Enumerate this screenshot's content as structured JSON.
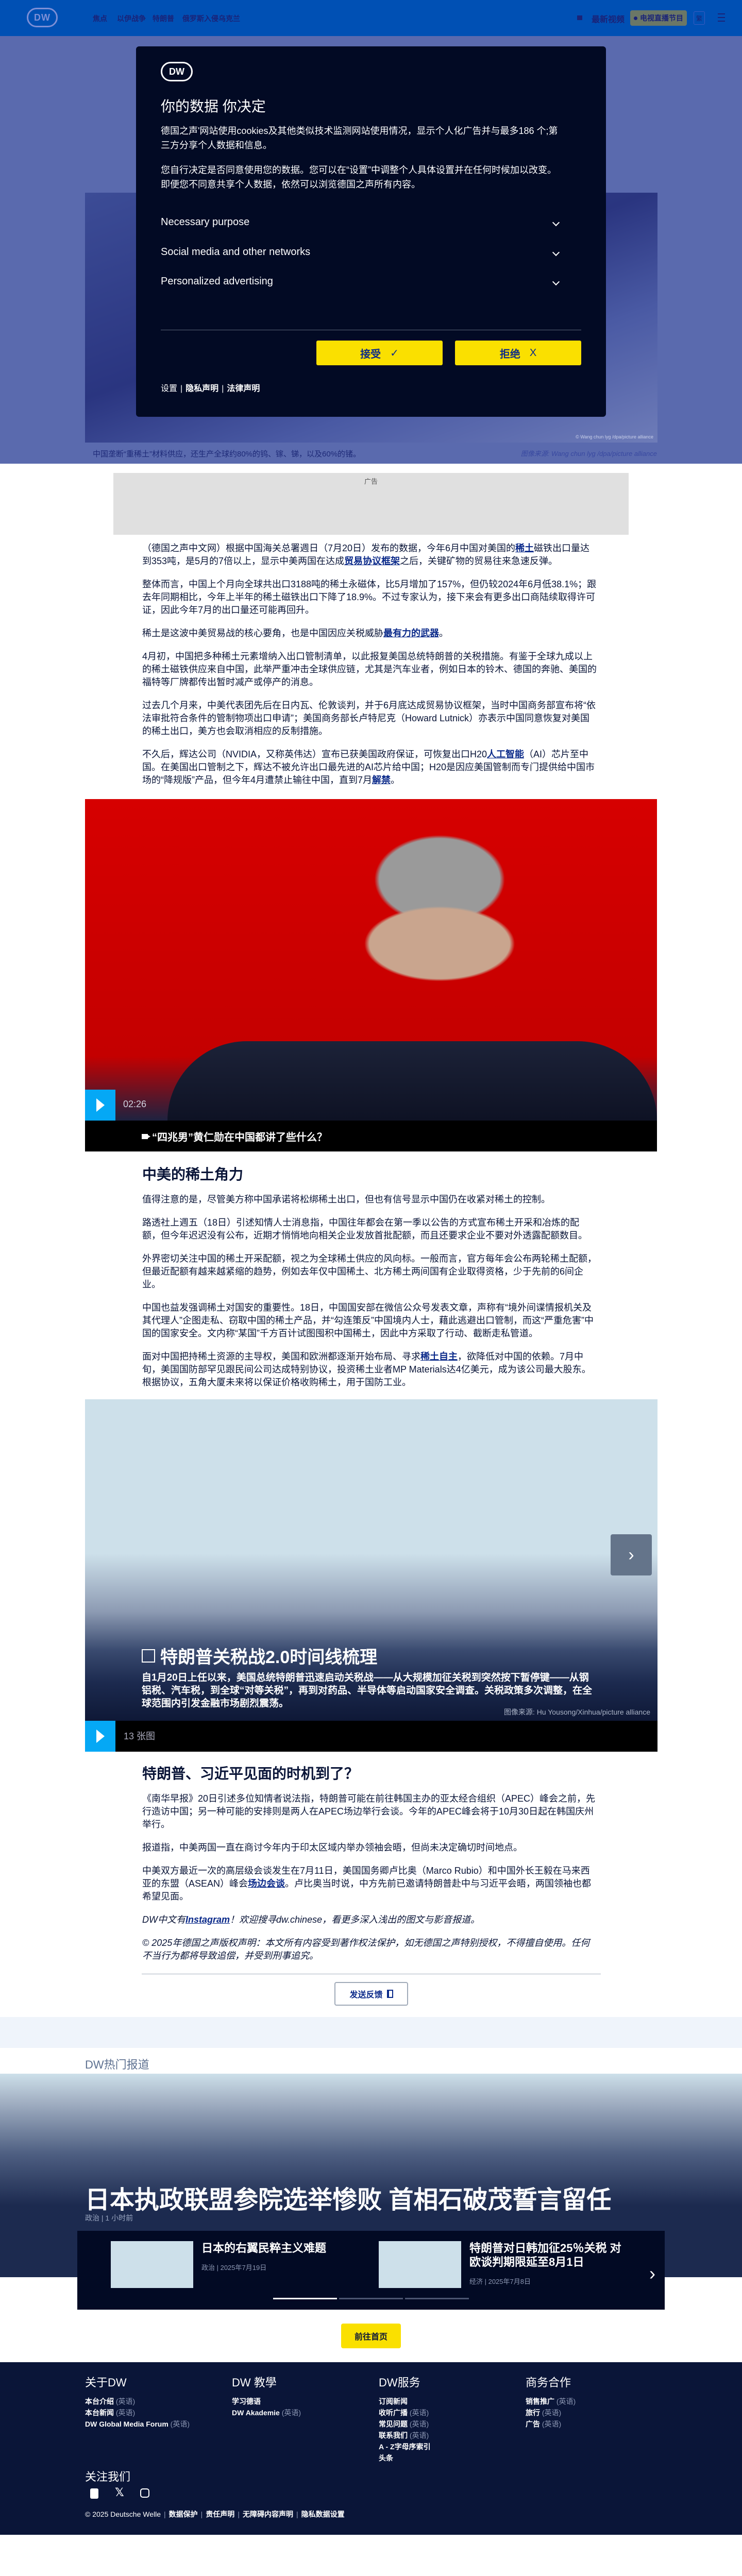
{
  "header": {
    "logo": "DW",
    "nav": [
      "焦点",
      "以伊战争",
      "特朗普",
      "俄罗斯入侵乌克兰"
    ],
    "latest_video": "最新视频",
    "live_tv": "电视直播节目",
    "lang": "繁"
  },
  "hero": {
    "caption": "中国垄断“重稀土”材料供应，还生产全球约80%的钨、镓、锑，以及60%的锗。",
    "credit": "图像来源: Wang chun lyg /dpa/picture alliance",
    "image_credit": "© Wang chun lyg /dpa/picture alliance"
  },
  "consent": {
    "logo": "DW",
    "title": "你的数据 你决定",
    "text1": "德国之声'网站使用cookies及其他类似技术监测网站使用情况，显示个人化广告并与最多186 个;第三方分享个人数据和信息。",
    "text2": "您自行决定是否同意使用您的数据。您可以在“设置”中调整个人具体设置并在任何时候加以改变。即便您不同意共享个人数据，依然可以浏览德国之声所有内容。",
    "sections": [
      "Necessary purpose",
      "Social media and other networks",
      "Personalized advertising"
    ],
    "accept": "接受",
    "accept_icon": "✓",
    "reject": "拒绝",
    "reject_icon": "X",
    "links": [
      "设置",
      "隐私声明",
      "法律声明"
    ]
  },
  "ad_label": "广告",
  "article": {
    "block1": [
      [
        {
          "t": "（德国之声中文网）根据中国海关总署週日（7月20日）发布的数据，今年6月中国对美国的"
        },
        {
          "t": "稀土",
          "link": true
        },
        {
          "t": "磁铁出口量达到353吨，是5月的7倍以上，显示中美两国在达成"
        },
        {
          "t": "贸易协议框架",
          "link": true
        },
        {
          "t": "之后，关键矿物的贸易往来急速反弹。"
        }
      ],
      [
        {
          "t": "整体而言，中国上个月向全球共出口3188吨的稀土永磁体，比5月增加了157%，但仍较2024年6月低38.1%；跟去年同期相比，今年上半年的稀土磁铁出口下降了18.9%。不过专家认为，接下来会有更多出口商陆续取得许可证，因此今年7月的出口量还可能再回升。"
        }
      ],
      [
        {
          "t": "稀土是这波中美贸易战的核心要角，也是中国因应关税威胁"
        },
        {
          "t": "最有力的武器",
          "link": true
        },
        {
          "t": "。"
        }
      ],
      [
        {
          "t": "4月初，中国把多种稀土元素增纳入出口管制清单，以此报复美国总统特朗普的关税措施。有鉴于全球九成以上的稀土磁铁供应来自中国，此举严重冲击全球供应链，尤其是汽车业者，例如日本的铃木、德国的奔驰、美国的福特等厂牌都传出暂时减产或停产的消息。"
        }
      ],
      [
        {
          "t": "过去几个月来，中美代表团先后在日内瓦、伦敦谈判，并于6月底达成贸易协议框架，当时中国商务部宣布将“依法审批符合条件的管制物项出口申请”；美国商务部长卢特尼克（Howard Lutnick）亦表示中国同意恢复对美国的稀土出口，美方也会取消相应的反制措施。"
        }
      ],
      [
        {
          "t": "不久后，辉达公司（NVIDIA，又称英伟达）宣布已获美国政府保证，可恢复出口H20"
        },
        {
          "t": "人工智能",
          "link": true
        },
        {
          "t": "（AI）芯片至中国。在美国出口管制之下，辉达不被允许出口最先进的AI芯片给中国；H20是因应美国管制而专门提供给中国市场的“降规版”产品，但今年4月遭禁止输往中国，直到7月"
        },
        {
          "t": "解禁",
          "link": true
        },
        {
          "t": "。"
        }
      ]
    ],
    "video": {
      "duration": "02:26",
      "title": "“四兆男”黄仁勋在中国都讲了些什么？"
    },
    "heading2": "中美的稀土角力",
    "block2": [
      [
        {
          "t": "值得注意的是，尽管美方称中国承诺将松绑稀土出口，但也有信号显示中国仍在收紧对稀土的控制。"
        }
      ],
      [
        {
          "t": "路透社上週五（18日）引述知情人士消息指，中国往年都会在第一季以公告的方式宣布稀土开采和冶炼的配额，但今年迟迟没有公布，近期才悄悄地向相关企业发放首批配额，而且还要求企业不要对外透露配额数目。"
        }
      ],
      [
        {
          "t": "外界密切关注中国的稀土开采配额，视之为全球稀土供应的风向标。一般而言，官方每年会公布两轮稀土配额，但最近配额有越来越紧缩的趋势，例如去年仅中国稀土、北方稀土两间国有企业取得资格，少于先前的6间企业。"
        }
      ],
      [
        {
          "t": "中国也益发强调稀土对国安的重要性。18日，中国国安部在微信公众号发表文章，声称有“境外间谍情报机关及其代理人”企图走私、窃取中国的稀土产品，并“勾连策反”中国境内人士，藉此逃避出口管制，而这“严重危害”中国的国家安全。文内称“某国”千方百计试图囤积中国稀土，因此中方采取了行动、截断走私管道。"
        }
      ],
      [
        {
          "t": "面对中国把持稀土资源的主导权，美国和欧洲都逐渐开始布局、寻求"
        },
        {
          "t": "稀土自主",
          "link": true
        },
        {
          "t": "，欲降低对中国的依赖。7月中旬，美国国防部罕见跟民间公司达成特别协议，投资稀土业者MP Materials达4亿美元，成为该公司最大股东。根据协议，五角大厦未来将以保证价格收购稀土，用于国防工业。"
        }
      ]
    ],
    "gallery": {
      "title": "特朗普关税战2.0时间线梳理",
      "description": "自1月20日上任以来，美国总统特朗普迅速启动关税战——从大规模加征关税到突然按下暂停键——从钢铝税、汽车税，到全球“对等关税”，再到对药品、半导体等启动国家安全调查。关税政策多次调整，在全球范围内引发金融市场剧烈震荡。",
      "credit": "图像来源: Hu Yousong/Xinhua/picture alliance",
      "count": "13 张图"
    },
    "heading3": "特朗普、习近平见面的时机到了？",
    "block3": [
      [
        {
          "t": "《南华早报》20日引述多位知情者说法指，特朗普可能在前往韩国主办的亚太经合组织（APEC）峰会之前，先行造访中国；另一种可能的安排则是两人在APEC场边举行会谈。今年的APEC峰会将于10月30日起在韩国庆州举行。"
        }
      ],
      [
        {
          "t": "报道指，中美两国一直在商讨今年内于印太区域内举办领袖会晤，但尚未决定确切时间地点。"
        }
      ],
      [
        {
          "t": "中美双方最近一次的高层级会谈发生在7月11日，美国国务卿卢比奥（Marco Rubio）和中国外长王毅在马来西亚的东盟（ASEAN）峰会"
        },
        {
          "t": "场边会谈",
          "link": true
        },
        {
          "t": "。卢比奥当时说，中方先前已邀请特朗普赴中与习近平会晤，两国领袖也都希望见面。"
        }
      ]
    ],
    "italic": [
      [
        {
          "t": "DW中文有"
        },
        {
          "t": "Instagram",
          "link": true
        },
        {
          "t": "！欢迎搜寻dw.chinese，看更多深入浅出的图文与影音报道。"
        }
      ],
      [
        {
          "t": "© 2025年德国之声版权声明：本文所有内容受到著作权法保护，如无德国之声特别授权，不得擅自使用。任何不当行为都将导致追偿，并受到刑事追究。"
        }
      ]
    ],
    "feedback": "发送反馈"
  },
  "trending": {
    "label": "DW热门报道",
    "title": "日本执政联盟参院选举惨败 首相石破茂誓言留任",
    "meta": "政治 | 1 小时前",
    "cards": [
      {
        "title": "日本的右翼民粹主义难题",
        "meta": "政治 | 2025年7月19日"
      },
      {
        "title": "特朗普对日韩加征25％关税 对欧谈判期限延至8月1日",
        "meta": "经济 | 2025年7月8日"
      }
    ],
    "slides": 3,
    "active_slide": 1
  },
  "home_button": "前往首页",
  "footer": {
    "columns": [
      {
        "title": "关于DW",
        "links": [
          {
            "t": "本台介绍",
            "en": "(英语)"
          },
          {
            "t": "本台新闻",
            "en": "(英语)"
          },
          {
            "t": "DW Global Media Forum",
            "en": "(英语)"
          }
        ]
      },
      {
        "title": "DW 教學",
        "links": [
          {
            "t": "学习德语"
          },
          {
            "t": "DW Akademie",
            "en": "(英语)"
          }
        ]
      },
      {
        "title": "DW服务",
        "links": [
          {
            "t": "订阅新闻"
          },
          {
            "t": "收听广播",
            "en": "(英语)"
          },
          {
            "t": "常见问题",
            "en": "(英语)"
          },
          {
            "t": "联系我们",
            "en": "(英语)"
          },
          {
            "t": "A - Z字母序索引"
          },
          {
            "t": "头条"
          }
        ]
      },
      {
        "title": "商务合作",
        "links": [
          {
            "t": "销售推广",
            "en": "(英语)"
          },
          {
            "t": "旅行",
            "en": "(英语)"
          },
          {
            "t": "广告",
            "en": "(英语)"
          }
        ]
      }
    ],
    "follow": "关注我们",
    "social": [
      "youtube-icon",
      "x-icon",
      "instagram-icon"
    ],
    "copyright": "© 2025 Deutsche Welle",
    "legal": [
      "数据保护",
      "责任声明",
      "无障碍内容声明",
      "隐私数据设置"
    ]
  }
}
